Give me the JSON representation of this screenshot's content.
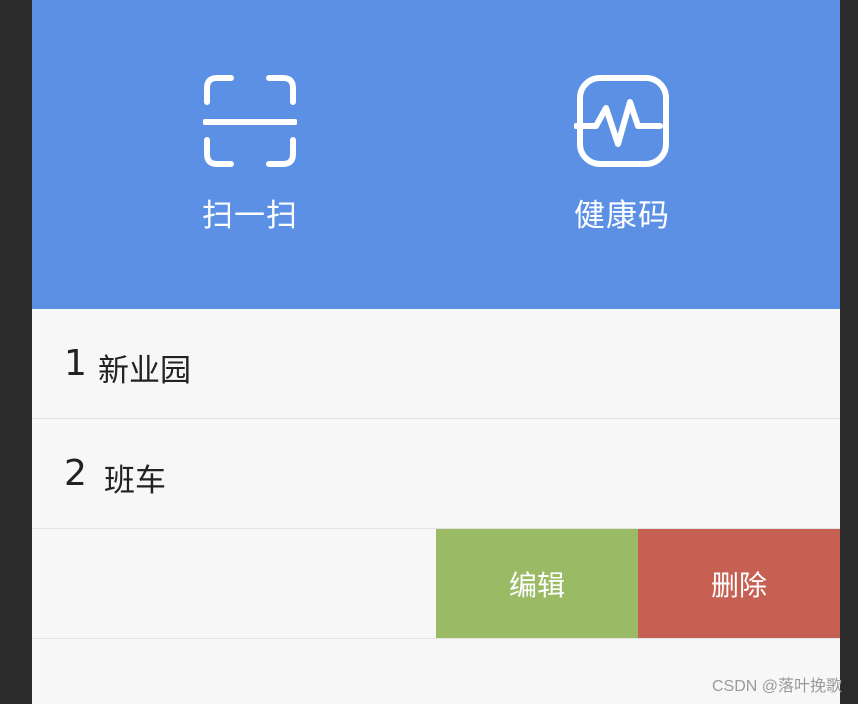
{
  "header": {
    "actions": [
      {
        "label": "扫一扫",
        "icon": "scan-icon"
      },
      {
        "label": "健康码",
        "icon": "health-code-icon"
      }
    ]
  },
  "list": {
    "items": [
      {
        "number": "1",
        "text": "新业园"
      },
      {
        "number": "2",
        "text": "班车"
      }
    ],
    "swipe_actions": {
      "edit": "编辑",
      "delete": "删除"
    }
  },
  "watermark": "CSDN @落叶挽歌",
  "colors": {
    "header_bg": "#5b90e4",
    "edit_bg": "#9aba66",
    "delete_bg": "#c66052",
    "list_bg": "#f7f7f7"
  }
}
